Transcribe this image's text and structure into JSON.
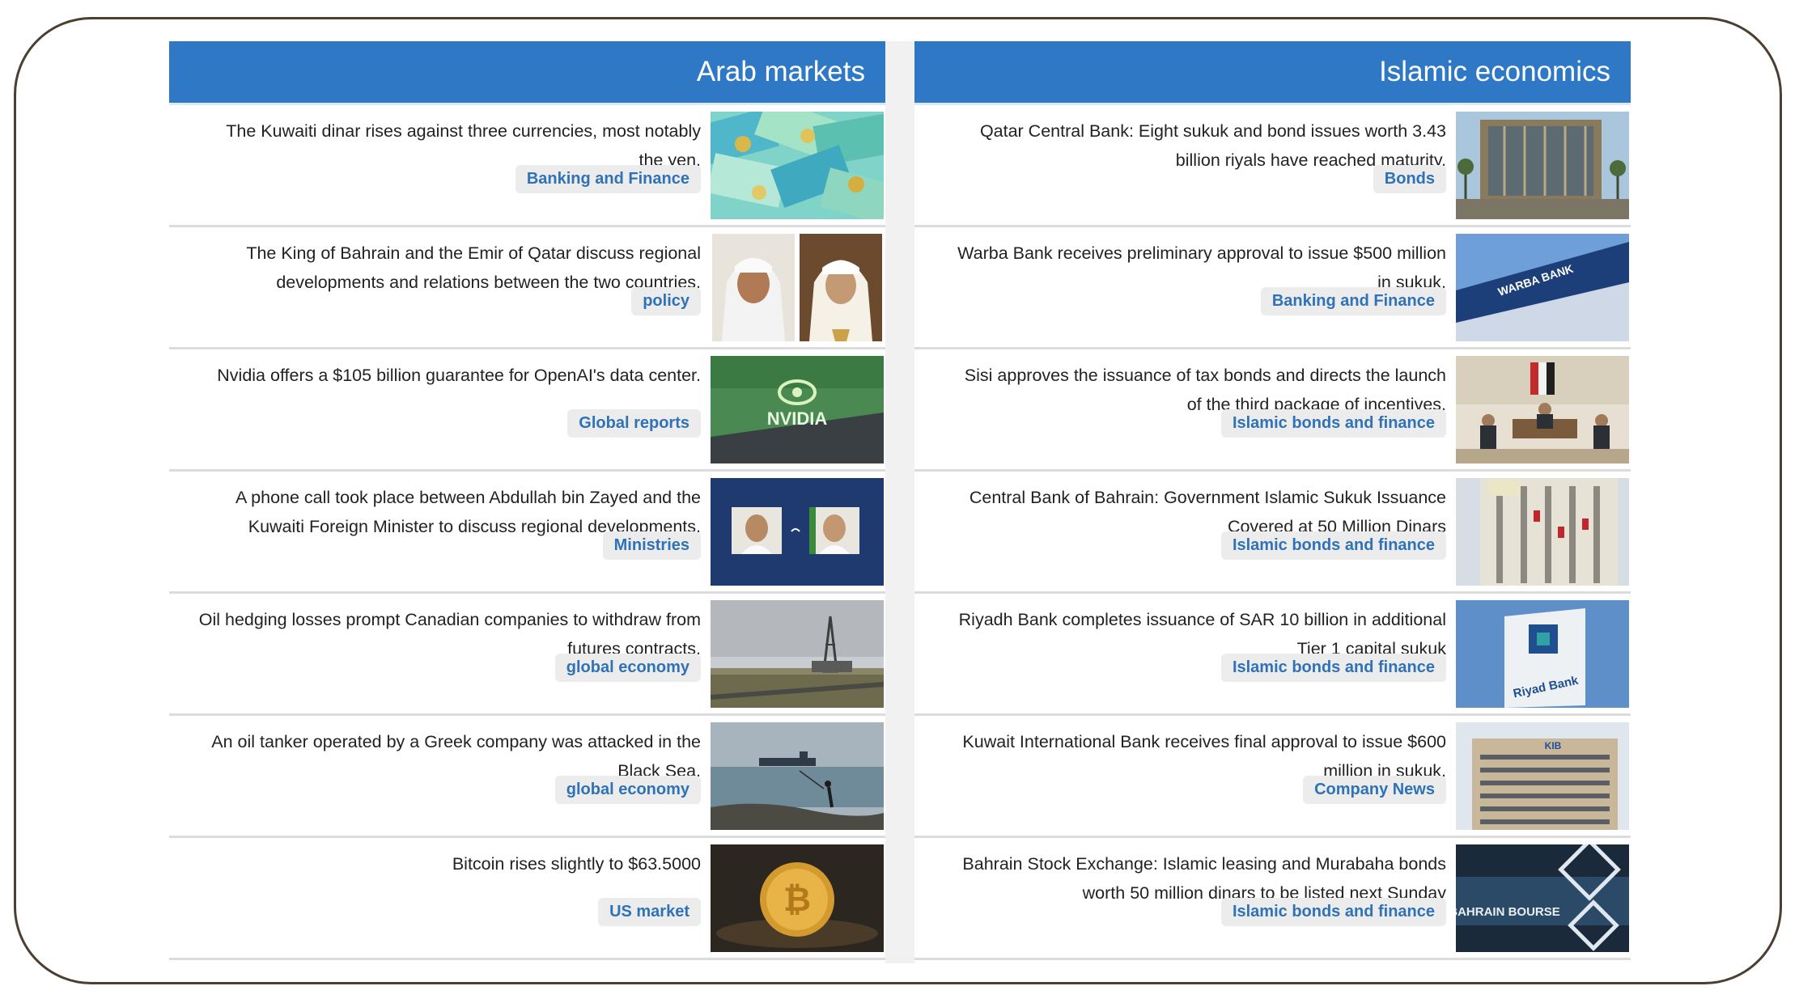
{
  "arab_markets": {
    "title": "Arab markets",
    "items": [
      {
        "text": "The Kuwaiti dinar rises against three currencies, most notably\nthe yen.",
        "tag": "Banking and Finance",
        "icon": "currency-banknotes-image"
      },
      {
        "text": "The King of Bahrain and the Emir of Qatar discuss regional\ndevelopments and relations between the two countries.",
        "tag": "policy",
        "icon": "leaders-portraits-image"
      },
      {
        "text": "Nvidia offers a $105 billion guarantee for OpenAI's data center.",
        "tag": "Global reports",
        "icon": "nvidia-building-image",
        "logo_text": "NVIDIA"
      },
      {
        "text": "A phone call took place between Abdullah bin Zayed and the\nKuwaiti Foreign Minister to discuss regional developments.",
        "tag": "Ministries",
        "icon": "officials-phone-call-image"
      },
      {
        "text": "Oil hedging losses prompt Canadian companies to withdraw from\nfutures contracts.",
        "tag": "global economy",
        "icon": "oil-rig-image"
      },
      {
        "text": "An oil tanker operated by a Greek company was attacked in the\nBlack Sea.",
        "tag": "global economy",
        "icon": "tanker-sea-image"
      },
      {
        "text": "Bitcoin rises slightly to $63.5000",
        "tag": "US market",
        "icon": "bitcoin-coin-image"
      }
    ]
  },
  "islamic_economics": {
    "title": "Islamic economics",
    "items": [
      {
        "text": "Qatar Central Bank: Eight sukuk and bond issues worth 3.43\nbillion riyals have reached maturity.",
        "tag": "Bonds",
        "icon": "central-bank-building-image"
      },
      {
        "text": "Warba Bank receives preliminary approval to issue $500 million\nin sukuk.",
        "tag": "Banking and Finance",
        "icon": "warba-bank-sign-image",
        "logo_text": "WARBA BANK"
      },
      {
        "text": "Sisi approves the issuance of tax bonds and directs the launch\nof the third package of incentives.",
        "tag": "Islamic bonds and finance",
        "icon": "government-meeting-image"
      },
      {
        "text": "Central Bank of Bahrain: Government Islamic Sukuk Issuance\nCovered at 50 Million Dinars",
        "tag": "Islamic bonds and finance",
        "icon": "bahrain-bank-building-image"
      },
      {
        "text": "Riyadh Bank completes issuance of SAR 10 billion in additional\nTier 1 capital sukuk",
        "tag": "Islamic bonds and finance",
        "icon": "riyad-bank-sign-image",
        "logo_text": "Riyad Bank"
      },
      {
        "text": "Kuwait International Bank receives final approval to issue $600\nmillion in sukuk.",
        "tag": "Company News",
        "icon": "kib-building-image",
        "logo_text": "KIB"
      },
      {
        "text": "Bahrain Stock Exchange: Islamic leasing and Murabaha bonds\nworth 50 million dinars to be listed next Sunday",
        "tag": "Islamic bonds and finance",
        "icon": "bahrain-bourse-image",
        "logo_text": "BAHRAIN BOURSE"
      }
    ]
  },
  "colors": {
    "header_blue": "#2e78c6",
    "tag_text": "#2f72b6",
    "frame": "#4a3f31"
  }
}
